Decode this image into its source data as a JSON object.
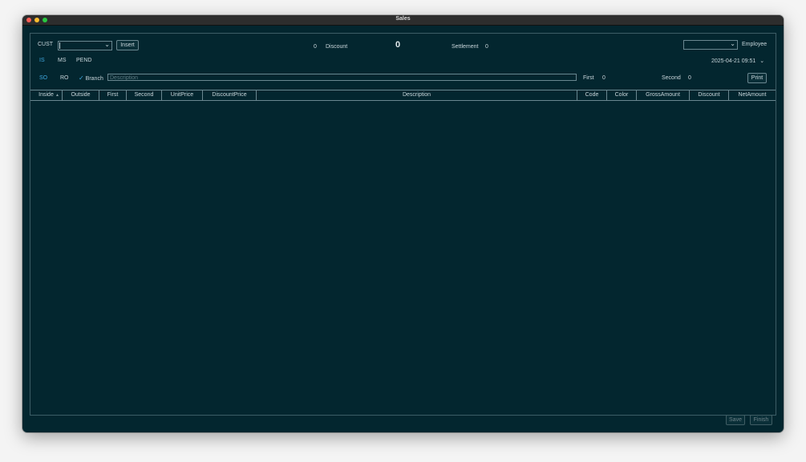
{
  "window": {
    "title": "Sales"
  },
  "toolbar": {
    "cust_label": "CUST",
    "insert_label": "Insert",
    "discount_count": "0",
    "discount_label": "Discount",
    "total": "0",
    "settlement_label": "Settlement",
    "settlement_value": "0",
    "employee_label": "Employee",
    "datetime": "2025-04-21 09:51"
  },
  "tabs1": [
    {
      "label": "IS",
      "active": true
    },
    {
      "label": "MS",
      "active": false
    },
    {
      "label": "PEND",
      "active": false
    }
  ],
  "tabs2": [
    {
      "label": "SO",
      "active": true
    },
    {
      "label": "RO",
      "active": false
    }
  ],
  "row3": {
    "branch_label": "Branch",
    "description_placeholder": "Description",
    "first_label": "First",
    "first_value": "0",
    "second_label": "Second",
    "second_value": "0",
    "print_label": "Print"
  },
  "table": {
    "columns": [
      "Inside",
      "Outside",
      "First",
      "Second",
      "UnitPrice",
      "DiscountPrice",
      "Description",
      "Code",
      "Color",
      "GrossAmount",
      "Discount",
      "NetAmount"
    ],
    "rows": []
  },
  "footer": {
    "save_label": "Save",
    "finish_label": "Finish"
  },
  "colors": {
    "background": "#03262f",
    "accent": "#3fa8e0",
    "border": "#6a8790"
  }
}
